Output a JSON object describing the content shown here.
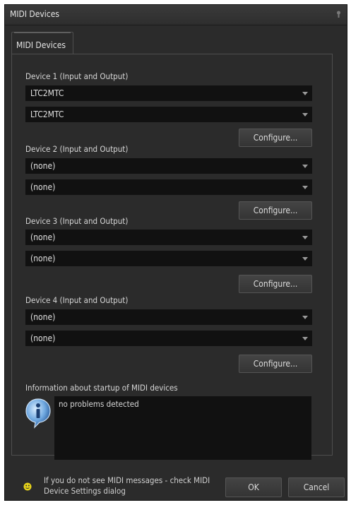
{
  "window": {
    "title": "MIDI Devices"
  },
  "tab": {
    "label": "MIDI Devices"
  },
  "devices": [
    {
      "label": "Device 1 (Input and Output)",
      "input": "LTC2MTC",
      "output": "LTC2MTC",
      "configure": "Configure..."
    },
    {
      "label": "Device 2 (Input and Output)",
      "input": "(none)",
      "output": "(none)",
      "configure": "Configure..."
    },
    {
      "label": "Device 3 (Input and Output)",
      "input": "(none)",
      "output": "(none)",
      "configure": "Configure..."
    },
    {
      "label": "Device 4 (Input and Output)",
      "input": "(none)",
      "output": "(none)",
      "configure": "Configure..."
    }
  ],
  "info": {
    "label": "Information about startup of MIDI devices",
    "text": "no problems detected"
  },
  "footer": {
    "hint_line1": "If you do not see MIDI messages - check MIDI",
    "hint_line2": "Device Settings dialog",
    "ok": "OK",
    "cancel": "Cancel"
  },
  "icons": {
    "info": "info-icon",
    "hint": "lightbulb-icon",
    "dropdown": "chevron-down-icon",
    "grip": "grip-icon"
  },
  "colors": {
    "background": "#2b2b2b",
    "field": "#111111",
    "text": "#e0e0e0",
    "border": "#4e4e4e"
  }
}
